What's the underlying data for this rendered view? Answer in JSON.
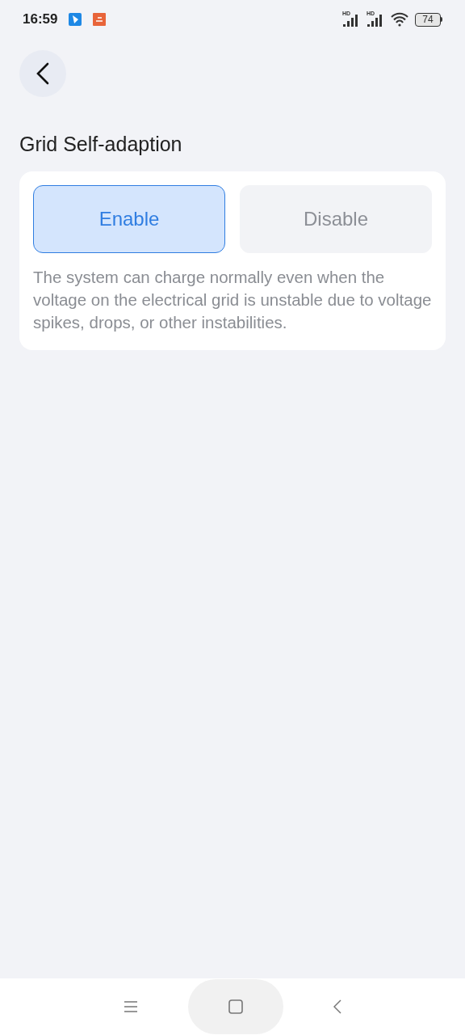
{
  "status_bar": {
    "time": "16:59",
    "signals": [
      {
        "label": "HD"
      },
      {
        "label": "HD"
      }
    ],
    "battery": "74"
  },
  "title": "Grid Self-adaption",
  "options": [
    {
      "label": "Enable",
      "selected": true
    },
    {
      "label": "Disable",
      "selected": false
    }
  ],
  "description": "The system can charge normally even when the voltage on the electrical grid is unstable due to voltage spikes, drops, or other instabilities."
}
